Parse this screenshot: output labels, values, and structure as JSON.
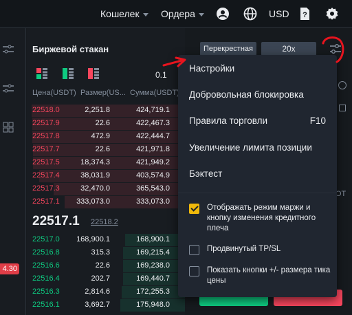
{
  "topbar": {
    "wallet_label": "Кошелек",
    "orders_label": "Ордера",
    "currency": "USD",
    "icons": [
      "user-icon",
      "globe-icon",
      "help-doc-icon",
      "gear-icon"
    ]
  },
  "leftstrip": {
    "price_badge": "4.30"
  },
  "orderbook": {
    "title": "Биржевой стакан",
    "precision": "0.1",
    "col_price": "Цена(USDT)",
    "col_size": "Размер(US...",
    "col_total": "Сумма(USDT)",
    "asks": [
      {
        "price": "22518.0",
        "size": "2,251.8",
        "total": "424,719.1",
        "depth": 0.97
      },
      {
        "price": "22517.9",
        "size": "22.6",
        "total": "422,467.3",
        "depth": 0.965
      },
      {
        "price": "22517.8",
        "size": "472.9",
        "total": "422,444.7",
        "depth": 0.965
      },
      {
        "price": "22517.7",
        "size": "22.6",
        "total": "421,971.8",
        "depth": 0.962
      },
      {
        "price": "22517.5",
        "size": "18,374.3",
        "total": "421,949.2",
        "depth": 0.962
      },
      {
        "price": "22517.4",
        "size": "38,031.9",
        "total": "403,574.9",
        "depth": 0.92
      },
      {
        "price": "22517.3",
        "size": "32,470.0",
        "total": "365,543.0",
        "depth": 0.83
      },
      {
        "price": "22517.1",
        "size": "333,073.0",
        "total": "333,073.0",
        "depth": 0.76
      }
    ],
    "last_price": "22517.1",
    "mark_price": "22518.2",
    "bids": [
      {
        "price": "22517.0",
        "size": "168,900.1",
        "total": "168,900.1",
        "depth": 0.38
      },
      {
        "price": "22516.8",
        "size": "315.3",
        "total": "169,215.4",
        "depth": 0.39
      },
      {
        "price": "22516.6",
        "size": "22.6",
        "total": "169,238.0",
        "depth": 0.39
      },
      {
        "price": "22516.4",
        "size": "202.7",
        "total": "169,440.7",
        "depth": 0.39
      },
      {
        "price": "22516.3",
        "size": "2,814.6",
        "total": "172,255.3",
        "depth": 0.4
      },
      {
        "price": "22516.1",
        "size": "3,692.7",
        "total": "175,948.0",
        "depth": 0.41
      }
    ]
  },
  "rightpanel": {
    "margin_mode": "Перекрестная",
    "leverage": "20x",
    "peek_text_1": "ОТ"
  },
  "settings_menu": {
    "items": [
      {
        "label": "Настройки"
      },
      {
        "label": "Добровольная блокировка"
      },
      {
        "label": "Правила торговли",
        "shortcut": "F10"
      },
      {
        "label": "Увеличение лимита позиции"
      },
      {
        "label": "Бэктест"
      }
    ],
    "options": [
      {
        "label": "Отображать режим маржи и кнопку изменения кредитного плеча",
        "checked": true
      },
      {
        "label": "Продвинутый TP/SL",
        "checked": false
      },
      {
        "label": "Показать кнопки +/- размера тика цены",
        "checked": false
      }
    ]
  },
  "colors": {
    "ask": "#f6465d",
    "bid": "#0ecb81",
    "accent": "#f0b90b",
    "annotation": "#e8141e"
  }
}
